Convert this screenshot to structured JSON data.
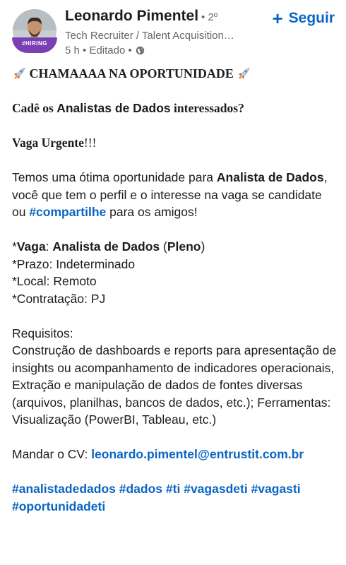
{
  "author": {
    "name": "Leonardo Pimentel",
    "degree": "• 2º",
    "headline": "Tech Recruiter / Talent Acquisition…",
    "meta": "5 h • Editado •",
    "badge": "#HIRING"
  },
  "follow_label": "Seguir",
  "post": {
    "title": "CHAMAAAA NA OPORTUNIDADE",
    "q_pre": "Cadê os ",
    "q_bold": "Analistas de Dados",
    "q_post": " interessados?",
    "urgent_bold": "Vaga Urgente",
    "urgent_rest": "!!!",
    "p1_a": "Temos uma ótima oportunidade para ",
    "p1_b": "Analista de Dados",
    "p1_c": ", você que tem o perfil e o interesse na vaga se candidate ou ",
    "p1_tag": "#compartilhe",
    "p1_d": " para os amigos!",
    "vaga_a": "*",
    "vaga_b": "Vaga",
    "vaga_c": ": ",
    "vaga_d": "Analista de Dados",
    "vaga_e": " (",
    "vaga_f": "Pleno",
    "vaga_g": ")",
    "prazo": "*Prazo: Indeterminado",
    "local": "*Local: Remoto",
    "contratacao": "*Contratação: PJ",
    "req_title": "Requisitos:",
    "req_text": "Construção de dashboards e reports para apresentação de insights ou acompanhamento de indicadores operacionais, Extração e manipulação de dados de fontes diversas (arquivos, planilhas, bancos de dados, etc.); Ferramentas: Visualização (PowerBI, Tableau, etc.)",
    "cv_label": "Mandar o CV: ",
    "cv_email": "leonardo.pimentel@entrustit.com.br",
    "hashtags": [
      "#analistadedados",
      "#dados",
      "#ti",
      "#vagasdeti",
      "#vagasti",
      "#oportunidadeti"
    ]
  },
  "colors": {
    "link": "#0a66c2",
    "badge": "#7b3fb5"
  },
  "icons": [
    "rocket-icon",
    "globe-icon",
    "plus-icon"
  ]
}
